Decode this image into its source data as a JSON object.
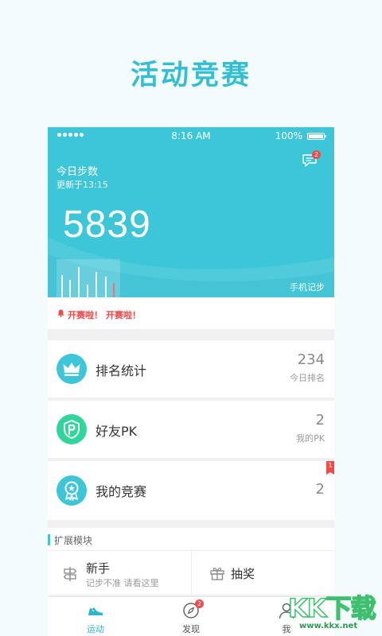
{
  "headline": "活动竞赛",
  "status_bar": {
    "time": "8:16 AM",
    "battery": "100%"
  },
  "hero": {
    "message_badge": "2",
    "title": "今日步数",
    "updated": "更新于13:15",
    "steps": "5839",
    "source": "手机记步"
  },
  "alert": {
    "text": "开赛啦！ 开赛啦！"
  },
  "rows": [
    {
      "label": "排名统计",
      "value": "234",
      "caption": "今日排名"
    },
    {
      "label": "好友PK",
      "value": "2",
      "caption": "我的PK"
    },
    {
      "label": "我的竞赛",
      "value": "2",
      "ribbon": "1"
    }
  ],
  "extensions": {
    "title": "扩展模块",
    "items": [
      {
        "label": "新手",
        "desc": "记步不准 请看这里"
      },
      {
        "label": "抽奖"
      }
    ]
  },
  "tabbar": {
    "tabs": [
      {
        "label": "运动"
      },
      {
        "label": "发现",
        "badge": "2"
      },
      {
        "label": "我"
      }
    ]
  },
  "watermark": {
    "big": "KK下载",
    "small": "www.kkx.net"
  },
  "colors": {
    "brand": "#3cc6d8",
    "alert": "#ee4a4a",
    "badge": "#f04a4a"
  }
}
